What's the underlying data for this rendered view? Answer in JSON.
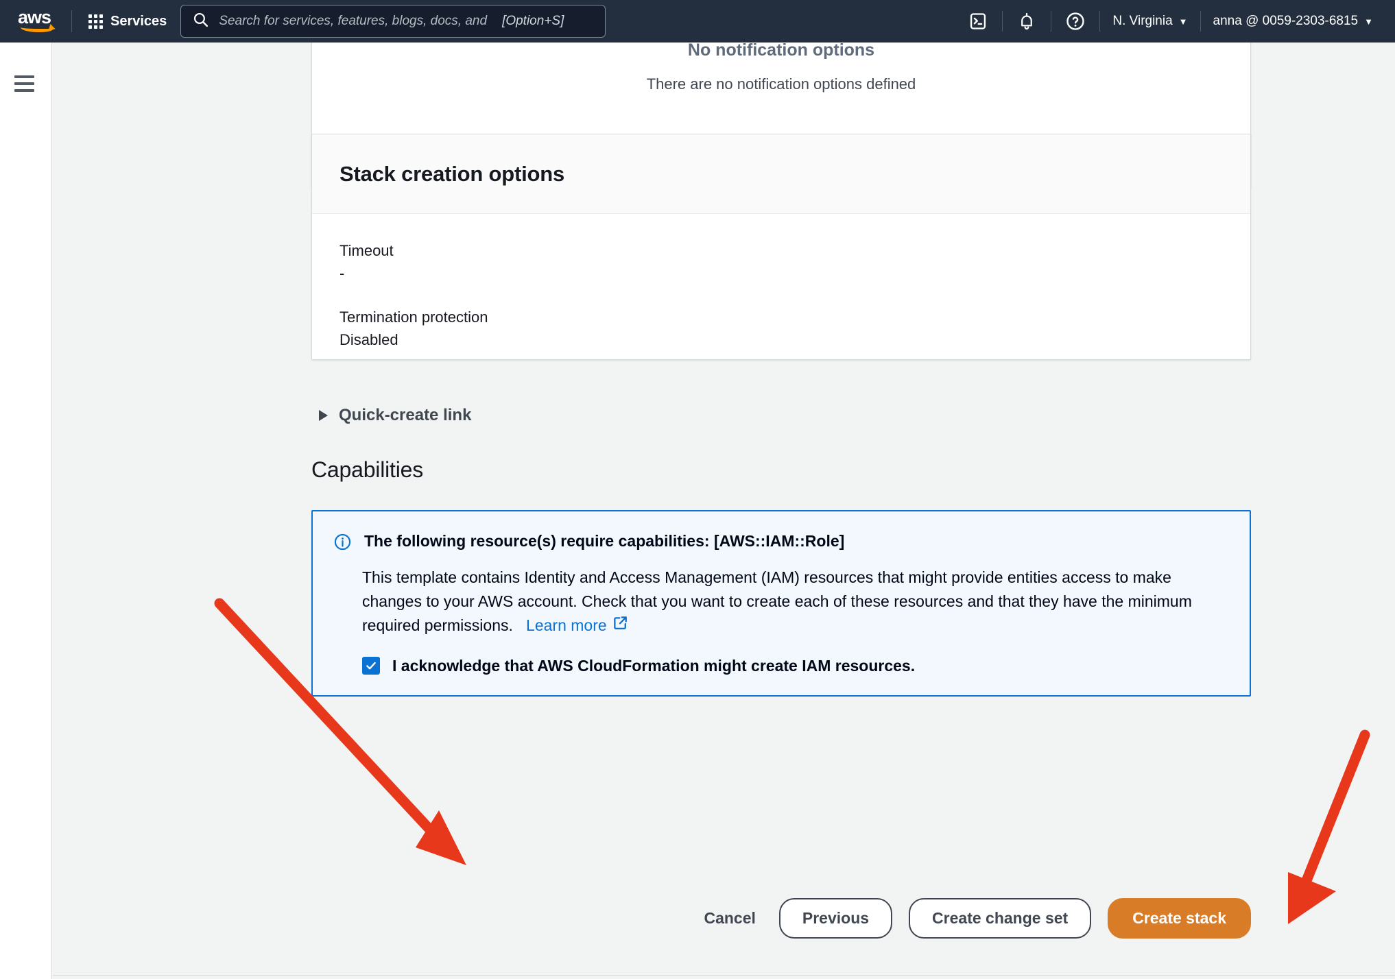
{
  "nav": {
    "logo_alt": "aws",
    "services_label": "Services",
    "search_placeholder": "Search for services, features, blogs, docs, and",
    "search_shortcut": "[Option+S]",
    "search_value": "",
    "cloudshell_icon": "cloudshell-icon",
    "notifications_icon": "bell-icon",
    "help_icon": "help-icon",
    "region_label": "N. Virginia",
    "account_label": "anna @ 0059-2303-6815",
    "caret": "▼"
  },
  "sidebar": {
    "menu_icon": "hamburger-menu-icon"
  },
  "notification_panel": {
    "title": "No notification options",
    "empty_text": "There are no notification options defined"
  },
  "stack_creation_options": {
    "title": "Stack creation options",
    "fields": [
      {
        "label": "Timeout",
        "value": "-"
      },
      {
        "label": "Termination protection",
        "value": "Disabled"
      }
    ]
  },
  "quick_create": {
    "label": "Quick-create link",
    "expanded": false,
    "icon": "triangle-right-icon"
  },
  "capabilities": {
    "heading": "Capabilities",
    "alert": {
      "icon": "info-icon",
      "title": "The following resource(s) require capabilities: [AWS::IAM::Role]",
      "body": "This template contains Identity and Access Management (IAM) resources that might provide entities access to make changes to your AWS account. Check that you want to create each of these resources and that they have the minimum required permissions.",
      "learn_more": "Learn more",
      "learn_more_icon": "external-link-icon",
      "checkbox_label": "I acknowledge that AWS CloudFormation might create IAM resources.",
      "checkbox_checked": true
    }
  },
  "footer": {
    "cancel": "Cancel",
    "previous": "Previous",
    "create_change_set": "Create change set",
    "create_stack": "Create stack"
  },
  "colors": {
    "nav_bg": "#232f3e",
    "page_bg": "#f2f3f3",
    "accent_blue": "#0972d3",
    "alert_bg": "#f2f8fd",
    "primary_orange": "#d97c28",
    "annotation_red": "#e8381c",
    "aws_orange": "#ff9900"
  },
  "annotations": {
    "arrow_to_checkbox": "red-arrow-pointing-to-acknowledge-checkbox",
    "arrow_to_create_stack": "red-arrow-pointing-to-create-stack-button"
  }
}
